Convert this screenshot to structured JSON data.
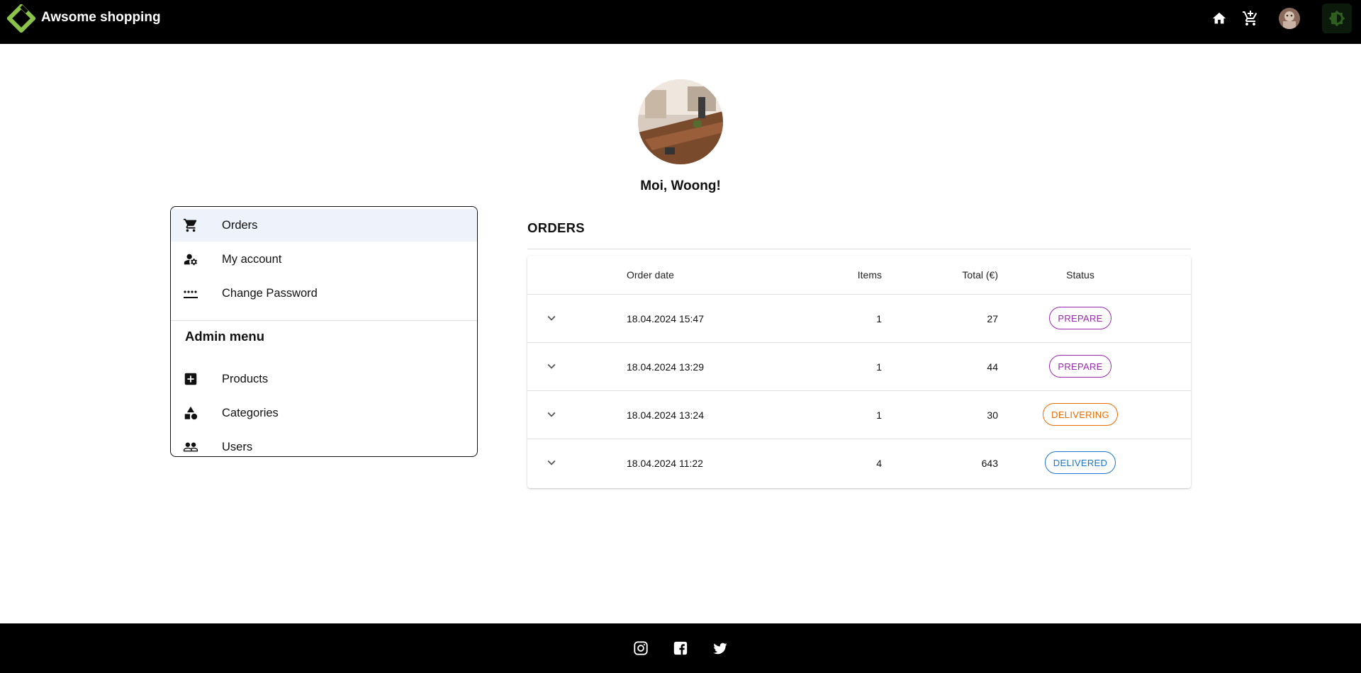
{
  "header": {
    "title": "Awsome shopping",
    "icons": [
      "logo-icon",
      "home-icon",
      "cart-icon",
      "avatar",
      "theme-toggle-icon"
    ],
    "accent_color": "#8bc34a"
  },
  "profile": {
    "greeting": "Moi, Woong!"
  },
  "side_menu": {
    "items": [
      {
        "label": "Orders",
        "icon": "cart-icon",
        "active": true
      },
      {
        "label": "My account",
        "icon": "manage-account-icon",
        "active": false
      },
      {
        "label": "Change Password",
        "icon": "password-icon",
        "active": false
      }
    ],
    "admin_heading": "Admin menu",
    "admin_items": [
      {
        "label": "Products",
        "icon": "add-box-icon"
      },
      {
        "label": "Categories",
        "icon": "category-icon"
      },
      {
        "label": "Users",
        "icon": "users-icon"
      }
    ]
  },
  "orders": {
    "title": "ORDERS",
    "columns": {
      "date": "Order date",
      "items": "Items",
      "total": "Total (€)",
      "status": "Status"
    },
    "rows": [
      {
        "date": "18.04.2024 15:47",
        "items": "1",
        "total": "27",
        "status": "PREPARE"
      },
      {
        "date": "18.04.2024 13:29",
        "items": "1",
        "total": "44",
        "status": "PREPARE"
      },
      {
        "date": "18.04.2024 13:24",
        "items": "1",
        "total": "30",
        "status": "DELIVERING"
      },
      {
        "date": "18.04.2024 11:22",
        "items": "4",
        "total": "643",
        "status": "DELIVERED"
      }
    ],
    "status_colors": {
      "PREPARE": "#9c27b0",
      "DELIVERING": "#ed6c02",
      "DELIVERED": "#1976d2"
    }
  },
  "footer": {
    "icons": [
      "instagram-icon",
      "facebook-icon",
      "twitter-icon"
    ]
  }
}
